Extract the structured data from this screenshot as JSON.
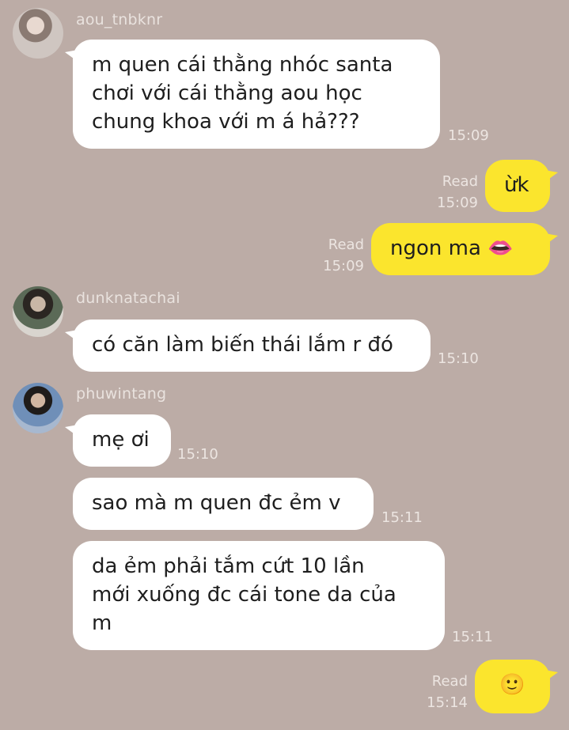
{
  "messages": [
    {
      "sender": "aou_tnbknr",
      "text": "m quen cái thằng nhóc santa\nchơi với cái thằng aou học\nchung khoa với m á hả???",
      "time": "15:09"
    },
    {
      "outgoing": true,
      "text": "ừk",
      "read": "Read",
      "time": "15:09"
    },
    {
      "outgoing": true,
      "text": "ngon ma 👄",
      "read": "Read",
      "time": "15:09"
    },
    {
      "sender": "dunknatachai",
      "text": "có căn làm biến thái lắm r đó",
      "time": "15:10"
    },
    {
      "sender": "phuwintang",
      "text": "mẹ ơi",
      "time": "15:10"
    },
    {
      "text": "sao mà m quen đc ẻm v",
      "time": "15:11"
    },
    {
      "text": "da ẻm phải tắm cứt 10 lần\nmới xuống đc cái tone da của\nm",
      "time": "15:11"
    },
    {
      "outgoing": true,
      "text": "🙂",
      "read": "Read",
      "time": "15:14"
    }
  ],
  "colors": {
    "background": "#bcaca6",
    "incoming_bubble": "#ffffff",
    "outgoing_bubble": "#fbe52d"
  }
}
